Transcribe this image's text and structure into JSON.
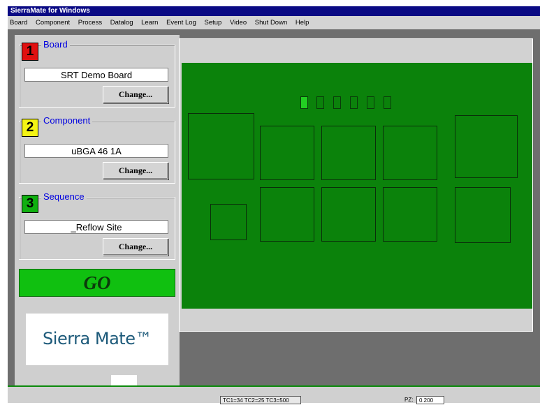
{
  "window": {
    "title": "SierraMate for Windows"
  },
  "menu": [
    {
      "label": "Board"
    },
    {
      "label": "Component"
    },
    {
      "label": "Process"
    },
    {
      "label": "Datalog"
    },
    {
      "label": "Learn"
    },
    {
      "label": "Event Log"
    },
    {
      "label": "Setup"
    },
    {
      "label": "Video"
    },
    {
      "label": "Shut Down"
    },
    {
      "label": "Help"
    }
  ],
  "panels": [
    {
      "number": "1",
      "title": "Board",
      "value": "SRT Demo Board",
      "button": "Change...",
      "number_color": "#e01010"
    },
    {
      "number": "2",
      "title": "Component",
      "value": "uBGA 46 1A",
      "button": "Change...",
      "number_color": "#f4f414"
    },
    {
      "number": "3",
      "title": "Sequence",
      "value": "_Reflow Site",
      "button": "Change...",
      "number_color": "#10b010"
    }
  ],
  "go_button": {
    "label": "GO",
    "color": "#10c010"
  },
  "logo": {
    "text": "Sierra Mate™"
  },
  "board_view": {
    "color": "#0b820b",
    "indicators": [
      {
        "state": "on"
      },
      {
        "state": "off"
      },
      {
        "state": "off"
      },
      {
        "state": "off"
      },
      {
        "state": "off"
      },
      {
        "state": "off"
      }
    ],
    "sites": [
      {
        "row": 1,
        "col": 1
      },
      {
        "row": 1,
        "col": 2
      },
      {
        "row": 1,
        "col": 3
      },
      {
        "row": 1,
        "col": 4
      },
      {
        "row": 1,
        "col": 5
      },
      {
        "row": 2,
        "col": 1
      },
      {
        "row": 2,
        "col": 2
      },
      {
        "row": 2,
        "col": 3
      },
      {
        "row": 2,
        "col": 4
      },
      {
        "row": 2,
        "col": 5
      }
    ]
  },
  "statusbar": {
    "tc_readout": "TC1=34 TC2=25 TC3=500",
    "pz_label": "PZ:",
    "pz_value": "0.200"
  }
}
